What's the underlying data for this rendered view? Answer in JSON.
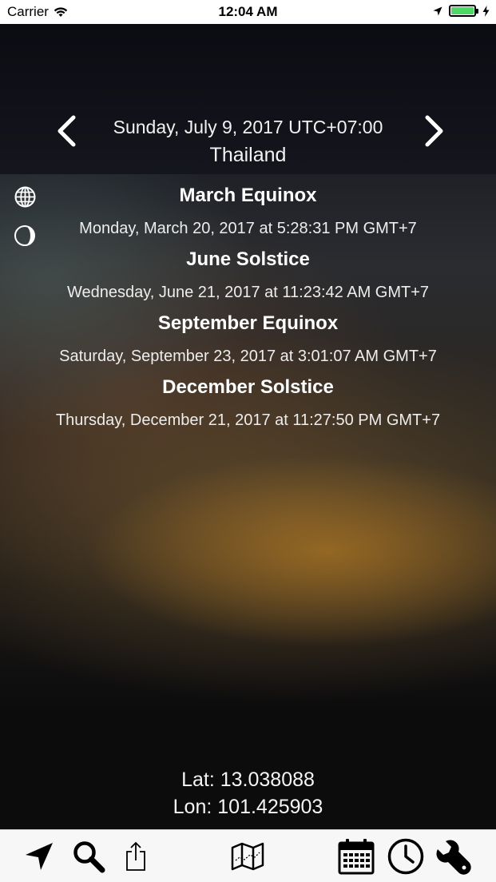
{
  "status_bar": {
    "carrier": "Carrier",
    "time": "12:04 AM",
    "battery_level": 1.0
  },
  "header": {
    "date": "Sunday, July 9, 2017 UTC+07:00",
    "location": "Thailand"
  },
  "events": [
    {
      "title": "March Equinox",
      "datetime": "Monday, March 20, 2017 at 5:28:31 PM GMT+7"
    },
    {
      "title": "June Solstice",
      "datetime": "Wednesday, June 21, 2017 at 11:23:42 AM GMT+7"
    },
    {
      "title": "September Equinox",
      "datetime": "Saturday, September 23, 2017 at 3:01:07 AM GMT+7"
    },
    {
      "title": "December Solstice",
      "datetime": "Thursday, December 21, 2017 at 11:27:50 PM GMT+7"
    }
  ],
  "coordinates": {
    "lat": "Lat: 13.038088",
    "lon": "Lon: 101.425903"
  },
  "toolbar": {
    "icons": [
      "location-arrow-icon",
      "search-icon",
      "share-icon",
      "map-icon",
      "calendar-icon",
      "clock-icon",
      "wrench-icon"
    ]
  },
  "colors": {
    "battery": "#4cd964",
    "toolbar_bg": "#f7f7f7"
  }
}
